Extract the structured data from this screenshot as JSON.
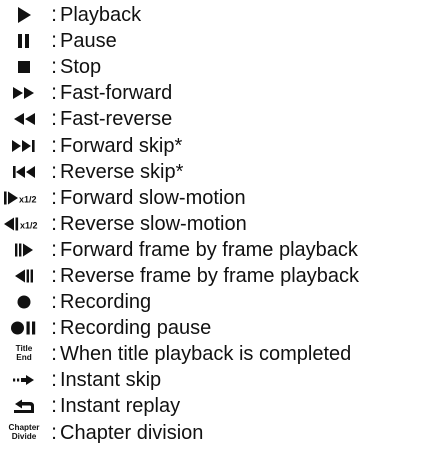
{
  "legend_items": [
    {
      "icon": "play-icon",
      "label": "Playback"
    },
    {
      "icon": "pause-icon",
      "label": "Pause"
    },
    {
      "icon": "stop-icon",
      "label": "Stop"
    },
    {
      "icon": "fast-forward-icon",
      "label": "Fast-forward"
    },
    {
      "icon": "fast-reverse-icon",
      "label": "Fast-reverse"
    },
    {
      "icon": "forward-skip-icon",
      "label": "Forward skip*"
    },
    {
      "icon": "reverse-skip-icon",
      "label": "Reverse skip*"
    },
    {
      "icon": "forward-slow-motion-icon",
      "label": "Forward slow-motion",
      "icon_text": "x1/2"
    },
    {
      "icon": "reverse-slow-motion-icon",
      "label": "Reverse slow-motion",
      "icon_text": "x1/2"
    },
    {
      "icon": "forward-frame-icon",
      "label": "Forward frame by frame playback"
    },
    {
      "icon": "reverse-frame-icon",
      "label": "Reverse frame by frame playback"
    },
    {
      "icon": "record-icon",
      "label": "Recording"
    },
    {
      "icon": "record-pause-icon",
      "label": "Recording pause"
    },
    {
      "icon": "title-end-icon",
      "label": "When title playback is completed",
      "icon_text": [
        "Title",
        "End"
      ]
    },
    {
      "icon": "instant-skip-icon",
      "label": "Instant skip"
    },
    {
      "icon": "instant-replay-icon",
      "label": "Instant replay"
    },
    {
      "icon": "chapter-divide-icon",
      "label": "Chapter division",
      "icon_text": [
        "Chapter",
        "Divide"
      ]
    }
  ],
  "separator": ":"
}
